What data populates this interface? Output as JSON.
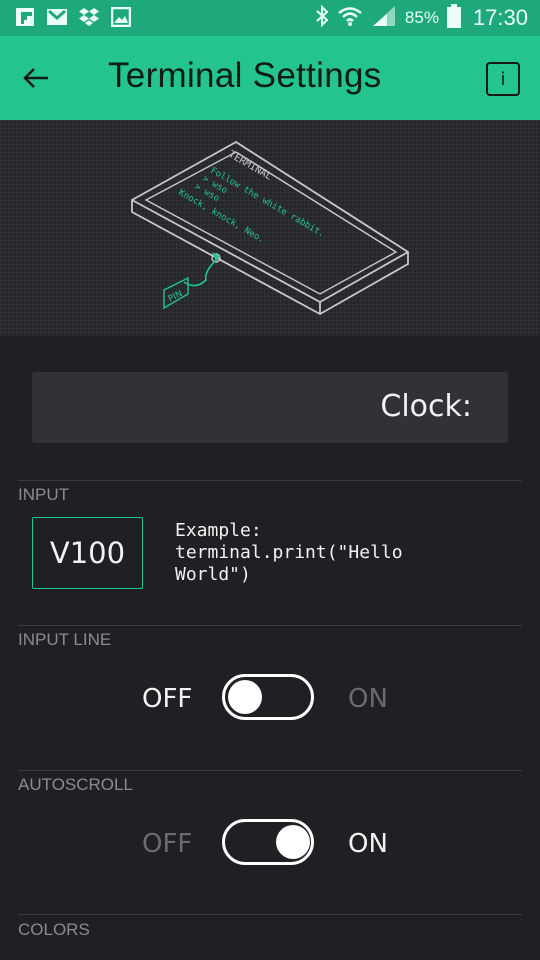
{
  "status_bar": {
    "left_icons": [
      "flipboard-icon",
      "gmail-icon",
      "dropbox-icon",
      "gallery-icon"
    ],
    "right_icons": [
      "bluetooth-icon",
      "wifi-icon",
      "signal-icon",
      "battery-icon"
    ],
    "battery": "85%",
    "time": "17:30"
  },
  "app_bar": {
    "title": "Terminal Settings",
    "info_label": "i"
  },
  "illustration": {
    "header": "TERMINAL",
    "lines": [
      "Follow the white rabbit.",
      "> wso",
      "> wso",
      "Knock, knock, Neo."
    ],
    "pin_label": "PIN"
  },
  "widget_name": {
    "value": "Clock:"
  },
  "input_section": {
    "label": "INPUT",
    "pin": "V100",
    "example": "Example:\nterminal.print(\"Hello\nWorld\")"
  },
  "input_line": {
    "label": "INPUT LINE",
    "off_label": "OFF",
    "on_label": "ON",
    "state": "off"
  },
  "autoscroll": {
    "label": "AUTOSCROLL",
    "off_label": "OFF",
    "on_label": "ON",
    "state": "on"
  },
  "colors_section": {
    "label": "COLORS"
  },
  "colors": {
    "accent": "#23c48e",
    "status_bar": "#1ea97c",
    "background": "#1f2023"
  }
}
